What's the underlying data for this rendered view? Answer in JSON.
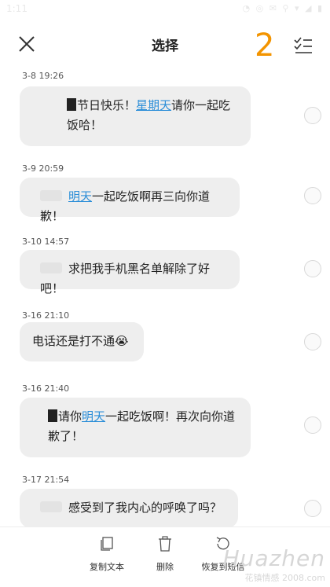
{
  "status_bar": {
    "time": "1:11",
    "icons": "◔ ◎ ✉ ⚲ ▾ ◢ ▮"
  },
  "header": {
    "title": "选择",
    "selected_count": "2",
    "close_icon": "close-icon",
    "select_all_icon": "select-all-icon"
  },
  "messages": [
    {
      "timestamp": "3-8 19:26",
      "parts": [
        [
          "blk",
          ""
        ],
        [
          "t",
          "节日快乐！"
        ],
        [
          "hl",
          "星期天"
        ],
        [
          "t",
          "请你一起吃饭哈！"
        ]
      ]
    },
    {
      "timestamp": "3-9 20:59",
      "parts": [
        [
          "fade",
          ""
        ],
        [
          "hl",
          "明天"
        ],
        [
          "t",
          "一起吃饭啊再三向你道歉！"
        ]
      ]
    },
    {
      "timestamp": "3-10 14:57",
      "parts": [
        [
          "fade",
          ""
        ],
        [
          "t",
          "求把我手机黑名单解除了好吧！"
        ]
      ]
    },
    {
      "timestamp": "3-16 21:10",
      "parts": [
        [
          "t",
          "电话还是打不通😭"
        ]
      ]
    },
    {
      "timestamp": "3-16 21:40",
      "parts": [
        [
          "blk",
          ""
        ],
        [
          "t",
          "请你"
        ],
        [
          "hl",
          "明天"
        ],
        [
          "t",
          "一起吃饭啊！再次向你道歉了！"
        ]
      ]
    },
    {
      "timestamp": "3-17 21:54",
      "parts": [
        [
          "fade",
          ""
        ],
        [
          "t",
          "感受到了我内心的呼唤了吗？"
        ]
      ]
    }
  ],
  "bottom_actions": [
    {
      "label": "复制文本",
      "icon": "copy-icon"
    },
    {
      "label": "删除",
      "icon": "trash-icon"
    },
    {
      "label": "恢复到短信",
      "icon": "restore-icon"
    }
  ],
  "watermark": {
    "line1": "Huazhen",
    "line2": "花镇情感 2008.com"
  },
  "colors": {
    "accent": "#f39400",
    "link": "#2b8ed8",
    "bubble": "#eeeeee"
  }
}
